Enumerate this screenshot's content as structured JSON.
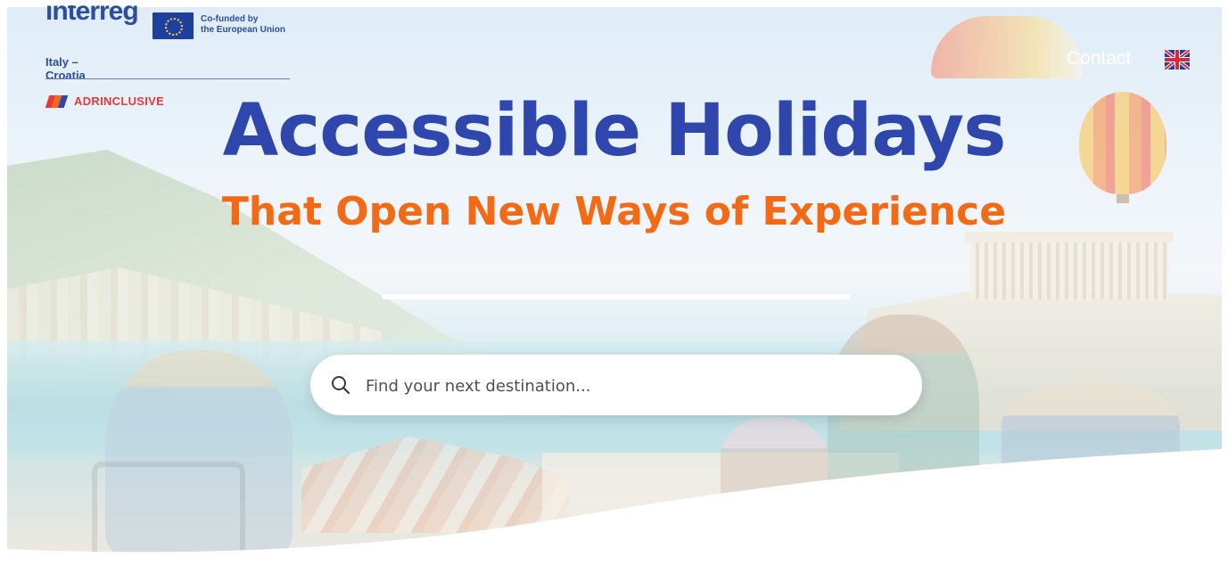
{
  "header": {
    "program_name": "interreg",
    "cofunded_line1": "Co-funded by",
    "cofunded_line2": "the European Union",
    "region": "Italy – Croatia",
    "brand": "ADRINCLUSIVE",
    "contact_label": "Contact",
    "language_flag": "uk-flag-icon"
  },
  "hero": {
    "headline": "Accessible Holidays",
    "subheadline": "That Open New Ways of Experience"
  },
  "search": {
    "placeholder": "Find your next destination...",
    "value": "",
    "icon": "search-icon"
  },
  "colors": {
    "headline": "#2f47ad",
    "subheadline": "#f36a16",
    "brand_red": "#e63a3a",
    "interreg_blue": "#2c4ea0"
  }
}
